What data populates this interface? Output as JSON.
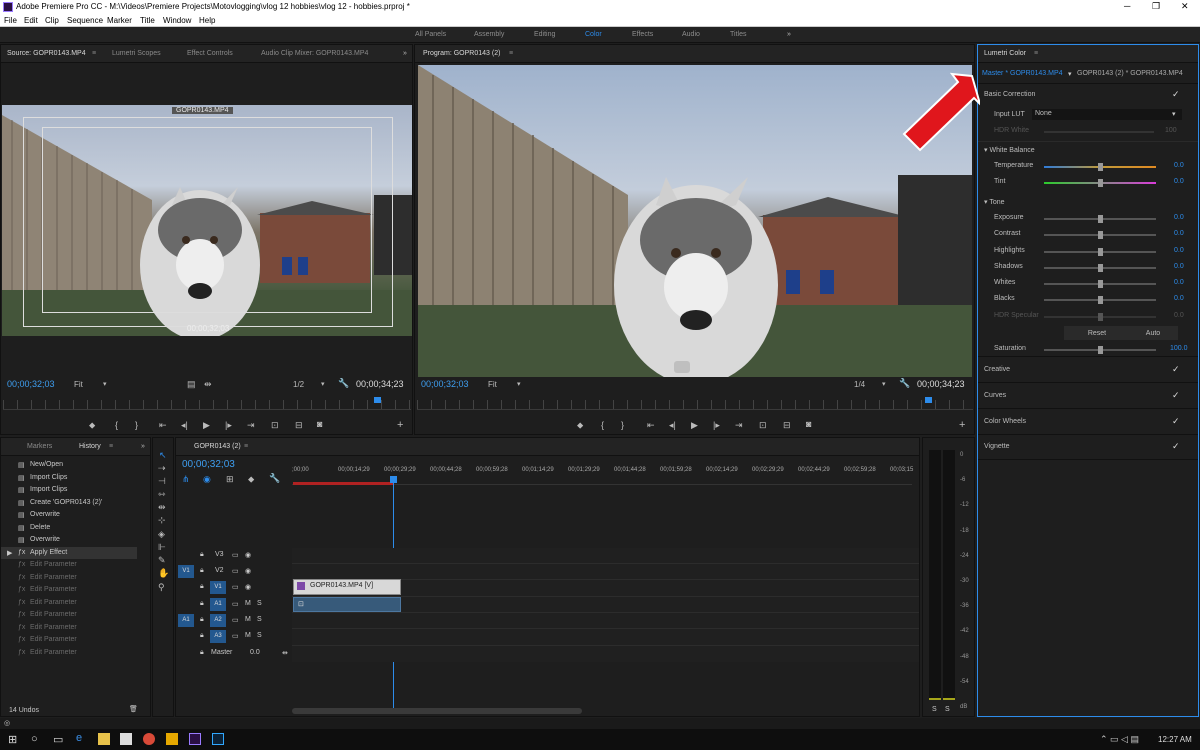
{
  "app": {
    "title": "Adobe Premiere Pro CC - M:\\Videos\\Premiere Projects\\Motovlogging\\vlog 12 hobbies\\vlog 12 - hobbies.prproj *",
    "window_controls": [
      "─",
      "❐",
      "✕"
    ]
  },
  "menu": [
    "File",
    "Edit",
    "Clip",
    "Sequence",
    "Marker",
    "Title",
    "Window",
    "Help"
  ],
  "workspaces": [
    "All Panels",
    "Assembly",
    "Editing",
    "Color",
    "Effects",
    "Audio",
    "Titles"
  ],
  "workspaces_more": "»",
  "accent": "#2d8ceb",
  "source_panel": {
    "tabs": [
      "Source: GOPR0143.MP4",
      "Lumetri Scopes",
      "Effect Controls",
      "Audio Clip Mixer: GOPR0143.MP4"
    ],
    "clip_label": "GOPR0143.MP4",
    "overlay_timecode": "00;00;32;03",
    "timecode": "00;00;32;03",
    "fit": "Fit",
    "resolution": "1/2",
    "duration": "00;00;34;23"
  },
  "program_panel": {
    "tab": "Program: GOPR0143 (2)",
    "timecode": "00;00;32;03",
    "fit": "Fit",
    "resolution": "1/4",
    "duration": "00;00;34;23"
  },
  "lumetri": {
    "title": "Lumetri Color",
    "master_tab": "Master * GOPR0143.MP4",
    "seq_tab": "GOPR0143 (2) * GOPR0143.MP4",
    "basic_correction": "Basic Correction",
    "input_lut_label": "Input LUT",
    "input_lut_value": "None",
    "hdr_white_label": "HDR White",
    "hdr_white_value": "100",
    "white_balance": "White Balance",
    "temperature": {
      "label": "Temperature",
      "value": "0.0"
    },
    "tint": {
      "label": "Tint",
      "value": "0.0"
    },
    "tone": "Tone",
    "tone_rows": [
      {
        "label": "Exposure",
        "value": "0.0"
      },
      {
        "label": "Contrast",
        "value": "0.0"
      },
      {
        "label": "Highlights",
        "value": "0.0"
      },
      {
        "label": "Shadows",
        "value": "0.0"
      },
      {
        "label": "Whites",
        "value": "0.0"
      },
      {
        "label": "Blacks",
        "value": "0.0"
      }
    ],
    "hdr_specular_label": "HDR Specular",
    "hdr_specular_value": "0.0",
    "reset": "Reset",
    "auto": "Auto",
    "saturation": {
      "label": "Saturation",
      "value": "100.0"
    },
    "sections": [
      "Creative",
      "Curves",
      "Color Wheels",
      "Vignette"
    ]
  },
  "history": {
    "tabs": [
      "Markers",
      "History"
    ],
    "items": [
      {
        "label": "New/Open",
        "active": true
      },
      {
        "label": "Import Clips",
        "active": true
      },
      {
        "label": "Import Clips",
        "active": true
      },
      {
        "label": "Create 'GOPR0143 (2)'",
        "active": true
      },
      {
        "label": "Overwrite",
        "active": true
      },
      {
        "label": "Delete",
        "active": true
      },
      {
        "label": "Overwrite",
        "active": true
      },
      {
        "label": "Apply Effect",
        "active": true
      },
      {
        "label": "Edit Parameter",
        "active": false
      },
      {
        "label": "Edit Parameter",
        "active": false
      },
      {
        "label": "Edit Parameter",
        "active": false
      },
      {
        "label": "Edit Parameter",
        "active": false
      },
      {
        "label": "Edit Parameter",
        "active": false
      },
      {
        "label": "Edit Parameter",
        "active": false
      },
      {
        "label": "Edit Parameter",
        "active": false
      },
      {
        "label": "Edit Parameter",
        "active": false
      }
    ],
    "undos": "14 Undos"
  },
  "timeline": {
    "tab": "GOPR0143 (2)",
    "timecode": "00;00;32;03",
    "ruler": [
      ";00;00",
      "00;00;14;29",
      "00;00;29;29",
      "00;00;44;28",
      "00;00;59;28",
      "00;01;14;29",
      "00;01;29;29",
      "00;01;44;28",
      "00;01;59;28",
      "00;02;14;29",
      "00;02;29;29",
      "00;02;44;29",
      "00;02;59;28",
      "00;03;15"
    ],
    "video_tracks": [
      "V3",
      "V2",
      "V1"
    ],
    "audio_tracks": [
      "A1",
      "A2",
      "A3"
    ],
    "source_v": "V1",
    "source_a": "A1",
    "master_label": "Master",
    "master_value": "0.0",
    "clip_label": "GOPR0143.MP4 [V]",
    "mute": "M",
    "solo": "S"
  },
  "meter": {
    "scale": [
      "0",
      "-6",
      "-12",
      "-18",
      "-24",
      "-30",
      "-36",
      "-42",
      "-48",
      "-54",
      "dB"
    ],
    "solo": [
      "S",
      "S"
    ]
  },
  "taskbar": {
    "time": "12:27 AM"
  }
}
